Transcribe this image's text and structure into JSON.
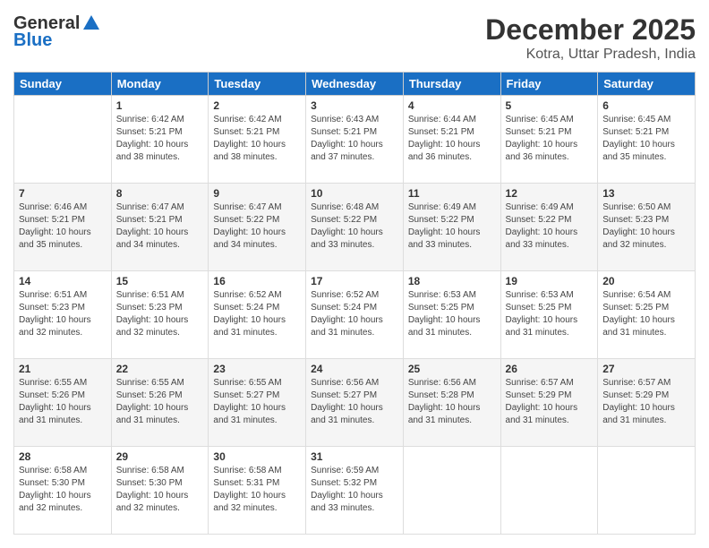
{
  "logo": {
    "text_general": "General",
    "text_blue": "Blue"
  },
  "header": {
    "title": "December 2025",
    "subtitle": "Kotra, Uttar Pradesh, India"
  },
  "weekdays": [
    "Sunday",
    "Monday",
    "Tuesday",
    "Wednesday",
    "Thursday",
    "Friday",
    "Saturday"
  ],
  "weeks": [
    [
      {
        "day": "",
        "info": ""
      },
      {
        "day": "1",
        "info": "Sunrise: 6:42 AM\nSunset: 5:21 PM\nDaylight: 10 hours\nand 38 minutes."
      },
      {
        "day": "2",
        "info": "Sunrise: 6:42 AM\nSunset: 5:21 PM\nDaylight: 10 hours\nand 38 minutes."
      },
      {
        "day": "3",
        "info": "Sunrise: 6:43 AM\nSunset: 5:21 PM\nDaylight: 10 hours\nand 37 minutes."
      },
      {
        "day": "4",
        "info": "Sunrise: 6:44 AM\nSunset: 5:21 PM\nDaylight: 10 hours\nand 36 minutes."
      },
      {
        "day": "5",
        "info": "Sunrise: 6:45 AM\nSunset: 5:21 PM\nDaylight: 10 hours\nand 36 minutes."
      },
      {
        "day": "6",
        "info": "Sunrise: 6:45 AM\nSunset: 5:21 PM\nDaylight: 10 hours\nand 35 minutes."
      }
    ],
    [
      {
        "day": "7",
        "info": "Sunrise: 6:46 AM\nSunset: 5:21 PM\nDaylight: 10 hours\nand 35 minutes."
      },
      {
        "day": "8",
        "info": "Sunrise: 6:47 AM\nSunset: 5:21 PM\nDaylight: 10 hours\nand 34 minutes."
      },
      {
        "day": "9",
        "info": "Sunrise: 6:47 AM\nSunset: 5:22 PM\nDaylight: 10 hours\nand 34 minutes."
      },
      {
        "day": "10",
        "info": "Sunrise: 6:48 AM\nSunset: 5:22 PM\nDaylight: 10 hours\nand 33 minutes."
      },
      {
        "day": "11",
        "info": "Sunrise: 6:49 AM\nSunset: 5:22 PM\nDaylight: 10 hours\nand 33 minutes."
      },
      {
        "day": "12",
        "info": "Sunrise: 6:49 AM\nSunset: 5:22 PM\nDaylight: 10 hours\nand 33 minutes."
      },
      {
        "day": "13",
        "info": "Sunrise: 6:50 AM\nSunset: 5:23 PM\nDaylight: 10 hours\nand 32 minutes."
      }
    ],
    [
      {
        "day": "14",
        "info": "Sunrise: 6:51 AM\nSunset: 5:23 PM\nDaylight: 10 hours\nand 32 minutes."
      },
      {
        "day": "15",
        "info": "Sunrise: 6:51 AM\nSunset: 5:23 PM\nDaylight: 10 hours\nand 32 minutes."
      },
      {
        "day": "16",
        "info": "Sunrise: 6:52 AM\nSunset: 5:24 PM\nDaylight: 10 hours\nand 31 minutes."
      },
      {
        "day": "17",
        "info": "Sunrise: 6:52 AM\nSunset: 5:24 PM\nDaylight: 10 hours\nand 31 minutes."
      },
      {
        "day": "18",
        "info": "Sunrise: 6:53 AM\nSunset: 5:25 PM\nDaylight: 10 hours\nand 31 minutes."
      },
      {
        "day": "19",
        "info": "Sunrise: 6:53 AM\nSunset: 5:25 PM\nDaylight: 10 hours\nand 31 minutes."
      },
      {
        "day": "20",
        "info": "Sunrise: 6:54 AM\nSunset: 5:25 PM\nDaylight: 10 hours\nand 31 minutes."
      }
    ],
    [
      {
        "day": "21",
        "info": "Sunrise: 6:55 AM\nSunset: 5:26 PM\nDaylight: 10 hours\nand 31 minutes."
      },
      {
        "day": "22",
        "info": "Sunrise: 6:55 AM\nSunset: 5:26 PM\nDaylight: 10 hours\nand 31 minutes."
      },
      {
        "day": "23",
        "info": "Sunrise: 6:55 AM\nSunset: 5:27 PM\nDaylight: 10 hours\nand 31 minutes."
      },
      {
        "day": "24",
        "info": "Sunrise: 6:56 AM\nSunset: 5:27 PM\nDaylight: 10 hours\nand 31 minutes."
      },
      {
        "day": "25",
        "info": "Sunrise: 6:56 AM\nSunset: 5:28 PM\nDaylight: 10 hours\nand 31 minutes."
      },
      {
        "day": "26",
        "info": "Sunrise: 6:57 AM\nSunset: 5:29 PM\nDaylight: 10 hours\nand 31 minutes."
      },
      {
        "day": "27",
        "info": "Sunrise: 6:57 AM\nSunset: 5:29 PM\nDaylight: 10 hours\nand 31 minutes."
      }
    ],
    [
      {
        "day": "28",
        "info": "Sunrise: 6:58 AM\nSunset: 5:30 PM\nDaylight: 10 hours\nand 32 minutes."
      },
      {
        "day": "29",
        "info": "Sunrise: 6:58 AM\nSunset: 5:30 PM\nDaylight: 10 hours\nand 32 minutes."
      },
      {
        "day": "30",
        "info": "Sunrise: 6:58 AM\nSunset: 5:31 PM\nDaylight: 10 hours\nand 32 minutes."
      },
      {
        "day": "31",
        "info": "Sunrise: 6:59 AM\nSunset: 5:32 PM\nDaylight: 10 hours\nand 33 minutes."
      },
      {
        "day": "",
        "info": ""
      },
      {
        "day": "",
        "info": ""
      },
      {
        "day": "",
        "info": ""
      }
    ]
  ]
}
